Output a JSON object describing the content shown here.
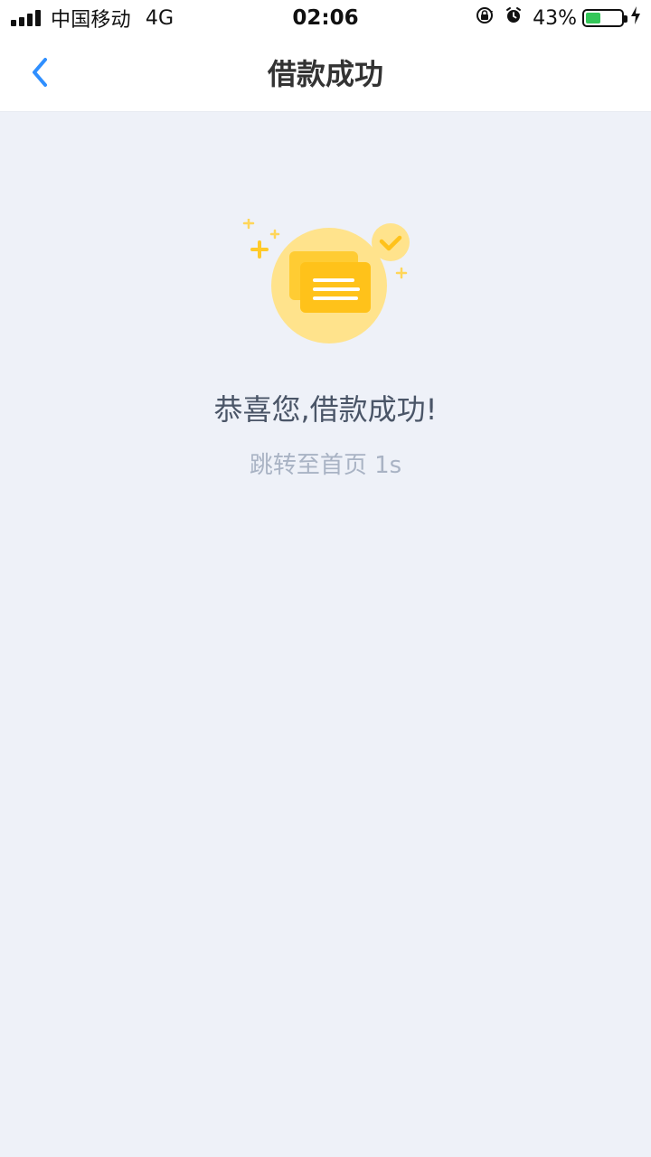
{
  "status_bar": {
    "carrier": "中国移动",
    "network": "4G",
    "time": "02:06",
    "battery_percent_text": "43%",
    "battery_level": 0.43,
    "icons": {
      "signal": "signal-bars-icon",
      "rotation_lock": "rotation-lock-icon",
      "alarm": "alarm-icon",
      "charging": "charging-bolt-icon"
    }
  },
  "nav": {
    "title": "借款成功",
    "back_icon": "chevron-left-icon"
  },
  "success": {
    "title": "恭喜您,借款成功!",
    "redirect_text": "跳转至首页 1s",
    "illustration_icon": "money-cards-success-icon"
  },
  "colors": {
    "accent_blue": "#2F8FFF",
    "illustration_yellow": "#FFC21A",
    "illustration_bg": "#FFE38C",
    "page_bg": "#EEF1F8",
    "battery_green": "#34C759"
  }
}
